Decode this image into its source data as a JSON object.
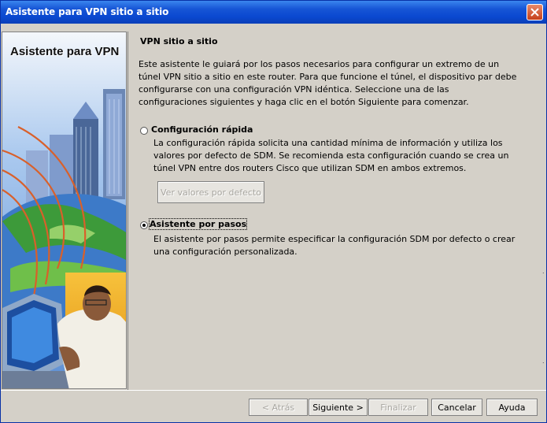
{
  "window": {
    "title": "Asistente para VPN sitio a sitio"
  },
  "side_panel": {
    "title": "Asistente para VPN"
  },
  "main": {
    "heading": "VPN sitio a sitio",
    "intro": "Este asistente le guiará por los pasos necesarios para configurar un extremo de un túnel VPN sitio a sitio en este router. Para que funcione el túnel, el dispositivo par debe configurarse con una configuración VPN idéntica. Seleccione una de las configuraciones siguientes y haga clic en el botón Siguiente para comenzar.",
    "options": [
      {
        "label": "Configuración rápida",
        "description": "La configuración rápida solicita una cantidad mínima de información y utiliza los valores por defecto de SDM. Se recomienda esta configuración cuando se crea un túnel VPN entre dos routers Cisco que utilizan SDM en ambos extremos.",
        "selected": false
      },
      {
        "label": "Asistente por pasos",
        "description": "El asistente por pasos permite especificar la configuración SDM por defecto o crear una configuración personalizada.",
        "selected": true
      }
    ],
    "defaults_button": "Ver valores por defecto"
  },
  "buttons": {
    "back": "< Atrás",
    "next": "Siguiente >",
    "finish": "Finalizar",
    "cancel": "Cancelar",
    "help": "Ayuda"
  },
  "colors": {
    "titlebar": "#0a48d0",
    "dialog_bg": "#d4d0c8",
    "close": "#c5401b"
  },
  "icons": {
    "close": "close-icon",
    "illustration": "vpn-wizard-illustration"
  }
}
